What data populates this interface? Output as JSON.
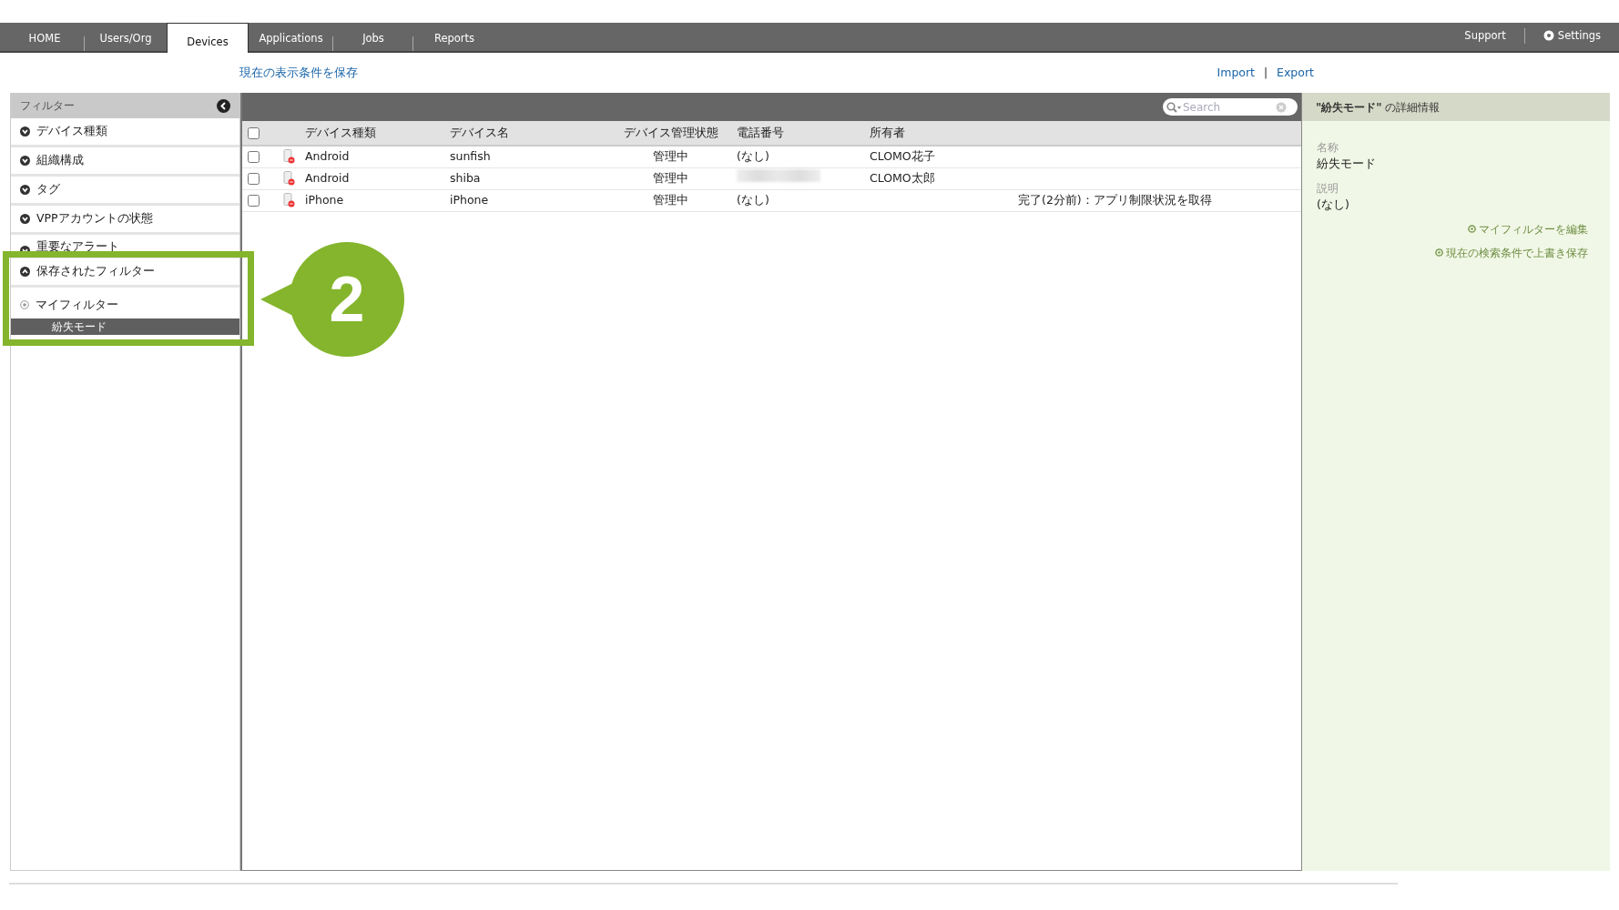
{
  "nav": {
    "tabs": [
      {
        "label": "HOME",
        "selected": false
      },
      {
        "label": "Users/Org",
        "selected": false
      },
      {
        "label": "Devices",
        "selected": true
      },
      {
        "label": "Applications",
        "selected": false
      },
      {
        "label": "Jobs",
        "selected": false
      },
      {
        "label": "Reports",
        "selected": false
      }
    ],
    "right": [
      {
        "label": "Support",
        "kind": "link"
      },
      {
        "label": "Settings",
        "kind": "gear"
      }
    ]
  },
  "toolbar": {
    "save_view": "現在の表示条件を保存",
    "import": "Import",
    "separator": "|",
    "export": "Export"
  },
  "sidebar": {
    "title": "フィルター",
    "sections": [
      {
        "label": "デバイス種類",
        "expanded": false
      },
      {
        "label": "組織構成",
        "expanded": false
      },
      {
        "label": "タグ",
        "expanded": false
      },
      {
        "label": "VPPアカウントの状態",
        "expanded": false
      },
      {
        "label": "重要なアラート",
        "expanded": false
      },
      {
        "label": "保存されたフィルター",
        "expanded": true,
        "children": [
          {
            "label": "マイフィルター",
            "children": [
              {
                "label": "紛失モード",
                "selected": true
              }
            ]
          }
        ]
      }
    ]
  },
  "table": {
    "search": {
      "placeholder": "Search"
    },
    "select_all_checked": false,
    "columns": [
      "デバイス種類",
      "デバイス名",
      "デバイス管理状態",
      "電話番号",
      "所有者"
    ],
    "rows": [
      {
        "checked": false,
        "type": "Android",
        "name": "sunfish",
        "status": "管理中",
        "phone": "(なし)",
        "owner": "CLOMO花子",
        "column_8": ""
      },
      {
        "checked": false,
        "type": "Android",
        "name": "shiba",
        "status": "管理中",
        "phone_blurred": true,
        "owner": "CLOMO太郎",
        "column_8": ""
      },
      {
        "checked": false,
        "type": "iPhone",
        "name": "iPhone",
        "status": "管理中",
        "phone": "(なし)",
        "owner": "",
        "column_8": "完了(2分前)：アプリ制限状況を取得"
      }
    ]
  },
  "detail": {
    "title_name": "\"紛失モード\"",
    "title_suffix": "の詳細情報",
    "fields": [
      {
        "label": "名称",
        "value": "紛失モード"
      },
      {
        "label": "説明",
        "value": "(なし)"
      }
    ],
    "actions": [
      "マイフィルターを編集",
      "現在の検索条件で上書き保存"
    ]
  },
  "callout": {
    "number": "2"
  }
}
